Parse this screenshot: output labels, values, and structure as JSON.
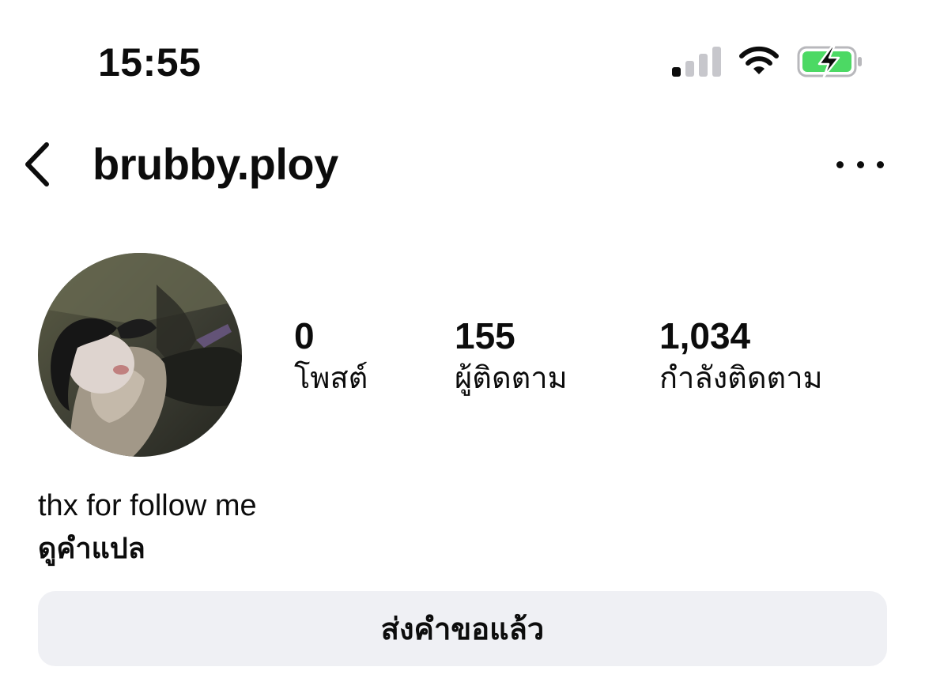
{
  "status_bar": {
    "time": "15:55",
    "signal_icon": "cellular-signal-icon",
    "wifi_icon": "wifi-icon",
    "battery_icon": "battery-charging-icon",
    "battery_color": "#4cd964"
  },
  "header": {
    "back_icon": "chevron-left-icon",
    "username": "brubby.ploy",
    "more_icon": "more-horizontal-icon"
  },
  "profile": {
    "stats": {
      "posts": {
        "value": "0",
        "label": "โพสต์"
      },
      "followers": {
        "value": "155",
        "label": "ผู้ติดตาม"
      },
      "following": {
        "value": "1,034",
        "label": "กำลังติดตาม"
      }
    },
    "bio": "thx for follow me",
    "see_translation": "ดูคำแปล",
    "request_button": "ส่งคำขอแล้ว"
  },
  "colors": {
    "text": "#0c0c0c",
    "button_bg": "#eff0f4",
    "signal_inactive": "#c7c7cc"
  }
}
